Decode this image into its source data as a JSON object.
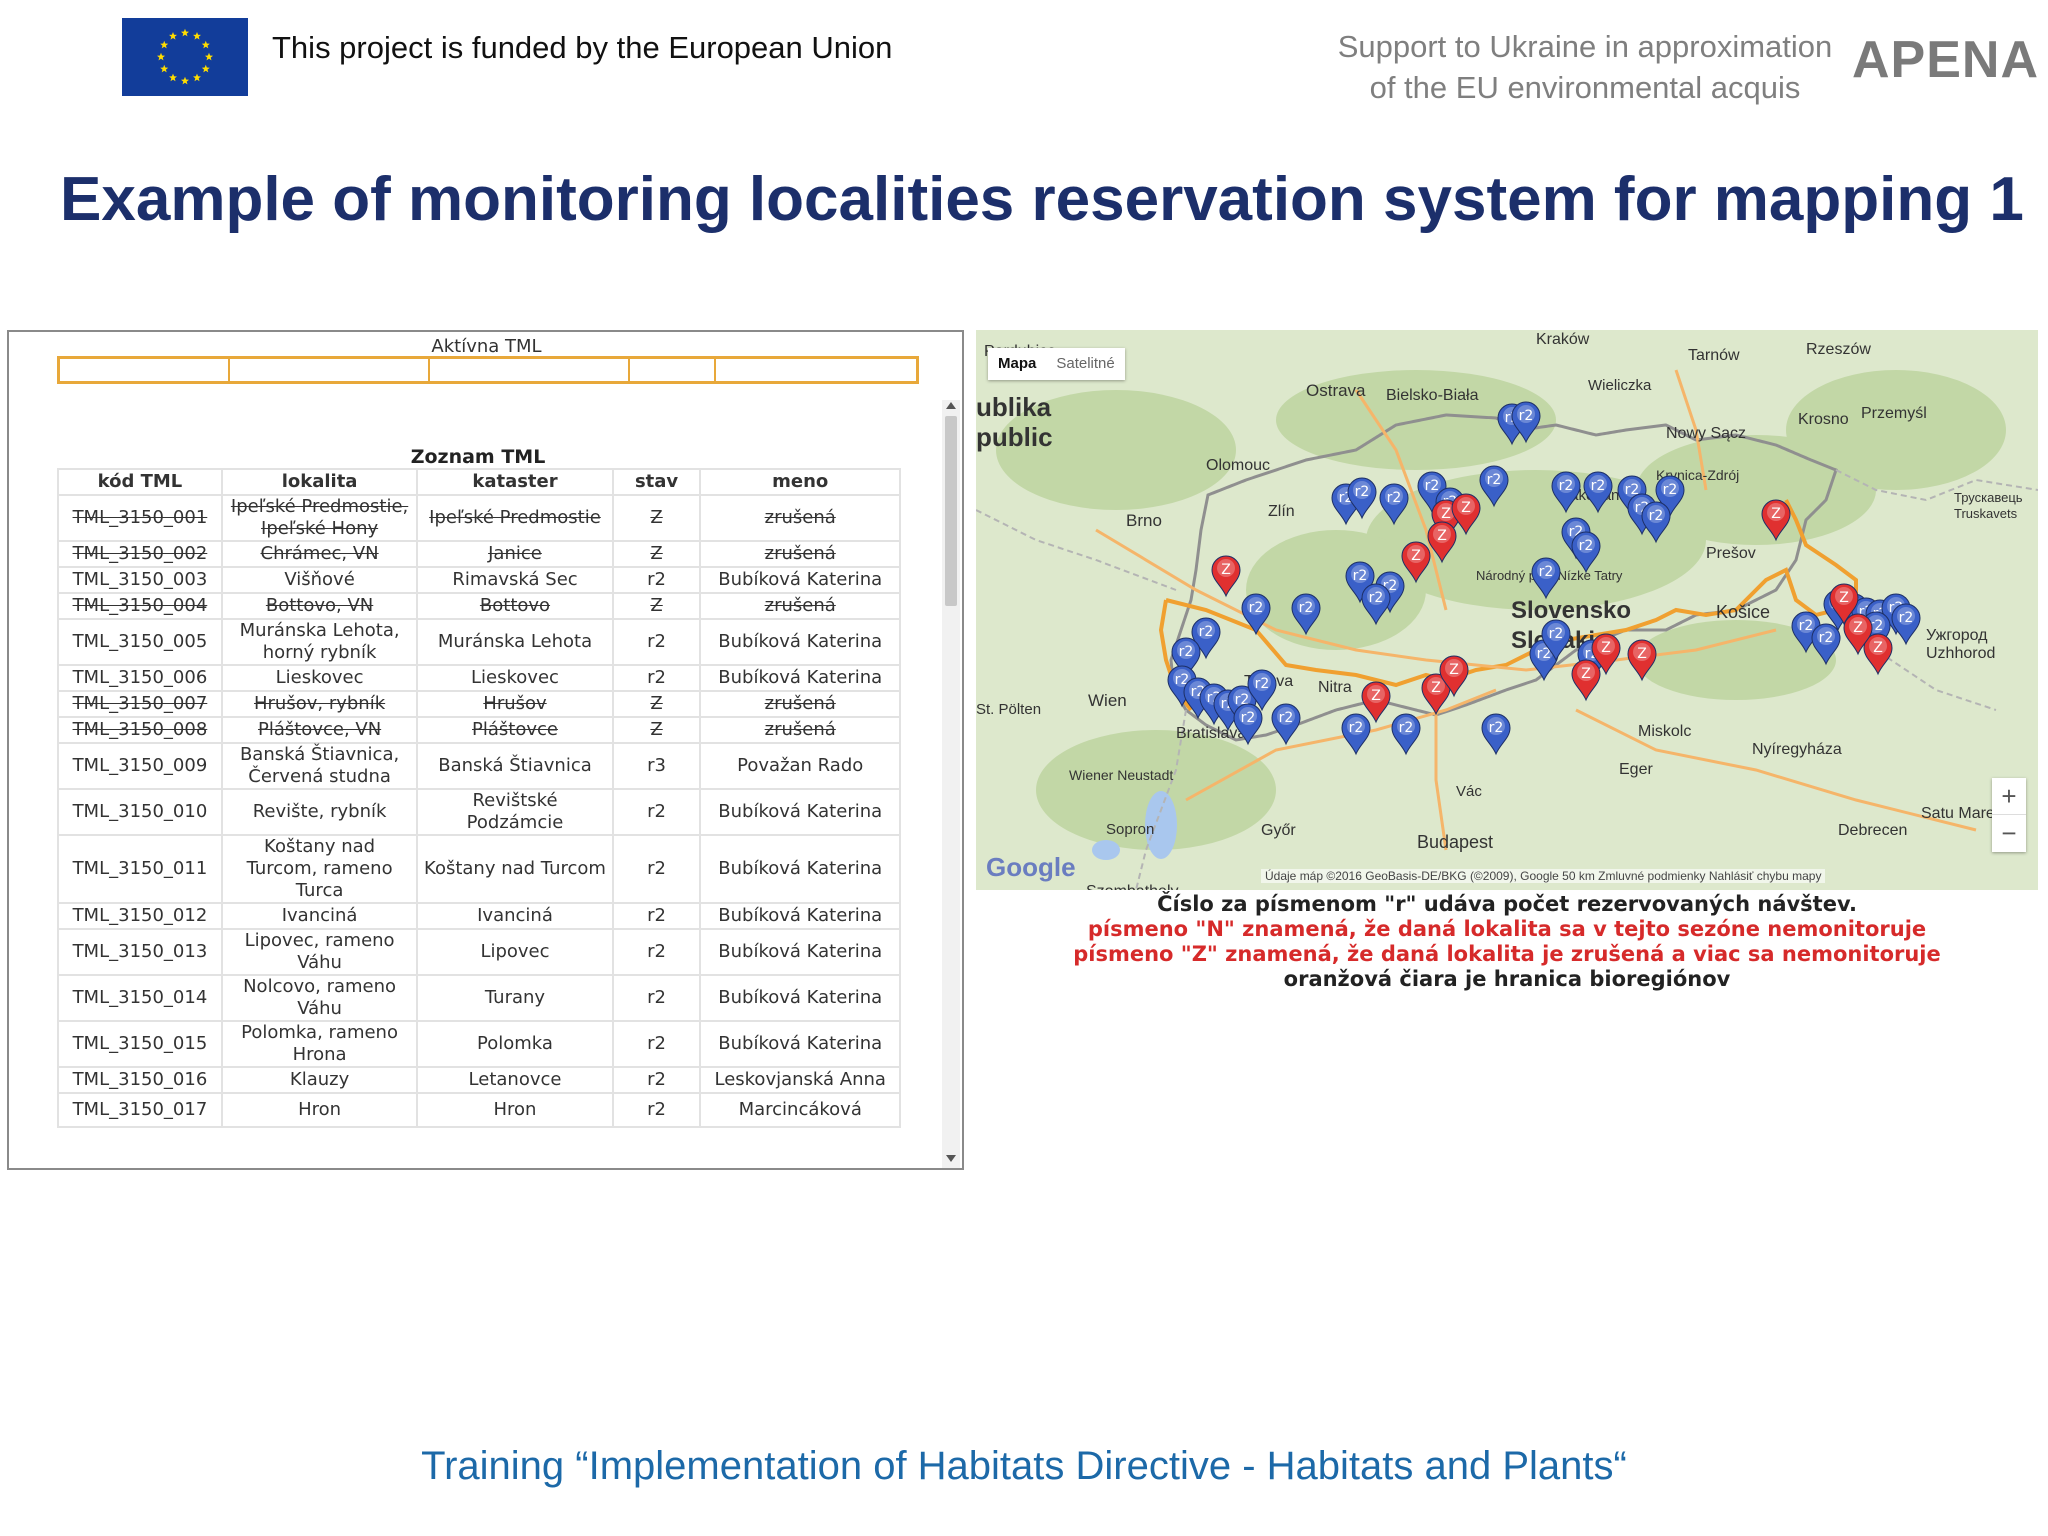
{
  "header": {
    "funded_text": "This project is funded by the European Union",
    "support_line1": "Support to Ukraine in approximation",
    "support_line2": "of the EU environmental acquis",
    "brand": "APENA",
    "eu_flag_icon": "eu-flag-icon"
  },
  "title": "Example of monitoring localities reservation system for mapping 1",
  "aktivna": {
    "title": "Aktívna TML"
  },
  "zoznam": {
    "title": "Zoznam TML",
    "columns": [
      "kód TML",
      "lokalita",
      "kataster",
      "stav",
      "meno"
    ],
    "rows": [
      {
        "code": "TML_3150_001",
        "lokalita": "Ipeľské Predmostie, Ipeľské Hony",
        "kataster": "Ipeľské Predmostie",
        "stav": "Z",
        "meno": "zrušená",
        "struck": true
      },
      {
        "code": "TML_3150_002",
        "lokalita": "Chrámec, VN",
        "kataster": "Janice",
        "stav": "Z",
        "meno": "zrušená",
        "struck": true
      },
      {
        "code": "TML_3150_003",
        "lokalita": "Višňové",
        "kataster": "Rimavská Sec",
        "stav": "r2",
        "meno": "Bubíková Katerina",
        "struck": false
      },
      {
        "code": "TML_3150_004",
        "lokalita": "Bottovo, VN",
        "kataster": "Bottovo",
        "stav": "Z",
        "meno": "zrušená",
        "struck": true
      },
      {
        "code": "TML_3150_005",
        "lokalita": "Muránska Lehota, horný rybník",
        "kataster": "Muránska Lehota",
        "stav": "r2",
        "meno": "Bubíková Katerina",
        "struck": false
      },
      {
        "code": "TML_3150_006",
        "lokalita": "Lieskovec",
        "kataster": "Lieskovec",
        "stav": "r2",
        "meno": "Bubíková Katerina",
        "struck": false
      },
      {
        "code": "TML_3150_007",
        "lokalita": "Hrušov, rybník",
        "kataster": "Hrušov",
        "stav": "Z",
        "meno": "zrušená",
        "struck": true
      },
      {
        "code": "TML_3150_008",
        "lokalita": "Pláštovce, VN",
        "kataster": "Pláštovce",
        "stav": "Z",
        "meno": "zrušená",
        "struck": true
      },
      {
        "code": "TML_3150_009",
        "lokalita": "Banská Štiavnica, Červená studna",
        "kataster": "Banská Štiavnica",
        "stav": "r3",
        "meno": "Považan Rado",
        "struck": false
      },
      {
        "code": "TML_3150_010",
        "lokalita": "Revište, rybník",
        "kataster": "Revištské Podzámcie",
        "stav": "r2",
        "meno": "Bubíková Katerina",
        "struck": false
      },
      {
        "code": "TML_3150_011",
        "lokalita": "Koštany nad Turcom, rameno Turca",
        "kataster": "Koštany nad Turcom",
        "stav": "r2",
        "meno": "Bubíková Katerina",
        "struck": false
      },
      {
        "code": "TML_3150_012",
        "lokalita": "Ivanciná",
        "kataster": "Ivanciná",
        "stav": "r2",
        "meno": "Bubíková Katerina",
        "struck": false
      },
      {
        "code": "TML_3150_013",
        "lokalita": "Lipovec, rameno Váhu",
        "kataster": "Lipovec",
        "stav": "r2",
        "meno": "Bubíková Katerina",
        "struck": false
      },
      {
        "code": "TML_3150_014",
        "lokalita": "Nolcovo, rameno Váhu",
        "kataster": "Turany",
        "stav": "r2",
        "meno": "Bubíková Katerina",
        "struck": false
      },
      {
        "code": "TML_3150_015",
        "lokalita": "Polomka, rameno Hrona",
        "kataster": "Polomka",
        "stav": "r2",
        "meno": "Bubíková Katerina",
        "struck": false
      },
      {
        "code": "TML_3150_016",
        "lokalita": "Klauzy",
        "kataster": "Letanovce",
        "stav": "r2",
        "meno": "Leskovjanská Anna",
        "struck": false
      },
      {
        "code": "TML_3150_017",
        "lokalita": "Hron",
        "kataster": "Hron",
        "stav": "r2",
        "meno": "Marcincáková",
        "struck": false
      }
    ]
  },
  "map": {
    "type_active": "Mapa",
    "type_inactive": "Satelitné",
    "zoom_in": "+",
    "zoom_out": "−",
    "logo": "Google",
    "attribution": "Údaje máp ©2016 GeoBasis-DE/BKG (©2009), Google   50 km   Zmluvné podmienky   Nahlásiť chybu mapy",
    "colors": {
      "land": "#dde8cc",
      "border": "#9a9a9a",
      "bioregion": "#f0a030",
      "reserved_marker": "#3a60c8",
      "cancelled_marker": "#e03030"
    },
    "places": [
      "Pardubice",
      "Kraków",
      "Tarnów",
      "Rzeszów",
      "ublika",
      "public",
      "Ostrava",
      "Bielsko-Biała",
      "Wieliczka",
      "Nowy Sącz",
      "Krosno",
      "Przemyśl",
      "Olomouc",
      "Zakopane",
      "Krynica-Zdrój",
      "Brno",
      "Zlín",
      "Prešov",
      "Трускавець",
      "Truskavets",
      "Národný park Nízke Tatry",
      "Slovensko",
      "Slovakia",
      "Košice",
      "Ужгород",
      "Uzhhorod",
      "St. Pölten",
      "Wien",
      "Trnava",
      "Nitra",
      "Bratislava",
      "Miskolc",
      "Nyíregyháza",
      "Eger",
      "Wiener Neustadt",
      "Vác",
      "Sopron",
      "Győr",
      "Budapest",
      "Debrecen",
      "Satu Mare",
      "Szombathely"
    ],
    "marker_label_reserved": "r2",
    "marker_label_cancelled": "Z"
  },
  "legend": {
    "line1": "Číslo za písmenom \"r\" udáva počet rezervovaných návštev.",
    "line2": "písmeno \"N\" znamená, že daná lokalita sa v tejto sezóne nemonitoruje",
    "line3": "písmeno \"Z\" znamená, že daná lokalita je zrušená a viac sa nemonitoruje",
    "line4": "oranžová čiara je hranica bioregiónov"
  },
  "footer": "Training “Implementation of Habitats Directive - Habitats and Plants“"
}
